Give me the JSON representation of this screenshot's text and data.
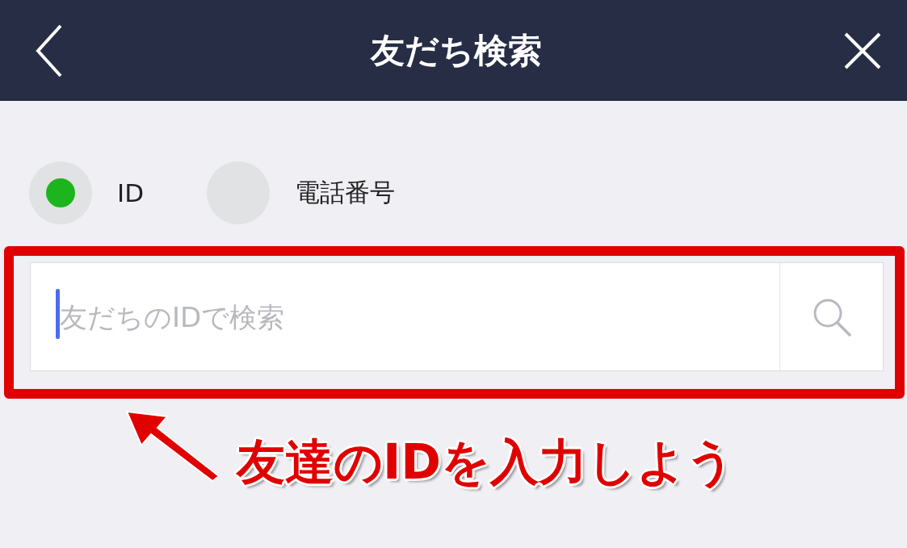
{
  "header": {
    "title": "友だち検索"
  },
  "search_type": [
    {
      "label": "ID",
      "selected": true
    },
    {
      "label": "電話番号",
      "selected": false
    }
  ],
  "search": {
    "placeholder": "友だちのIDで検索"
  },
  "annotation": {
    "text": "友達のIDを入力しよう"
  }
}
